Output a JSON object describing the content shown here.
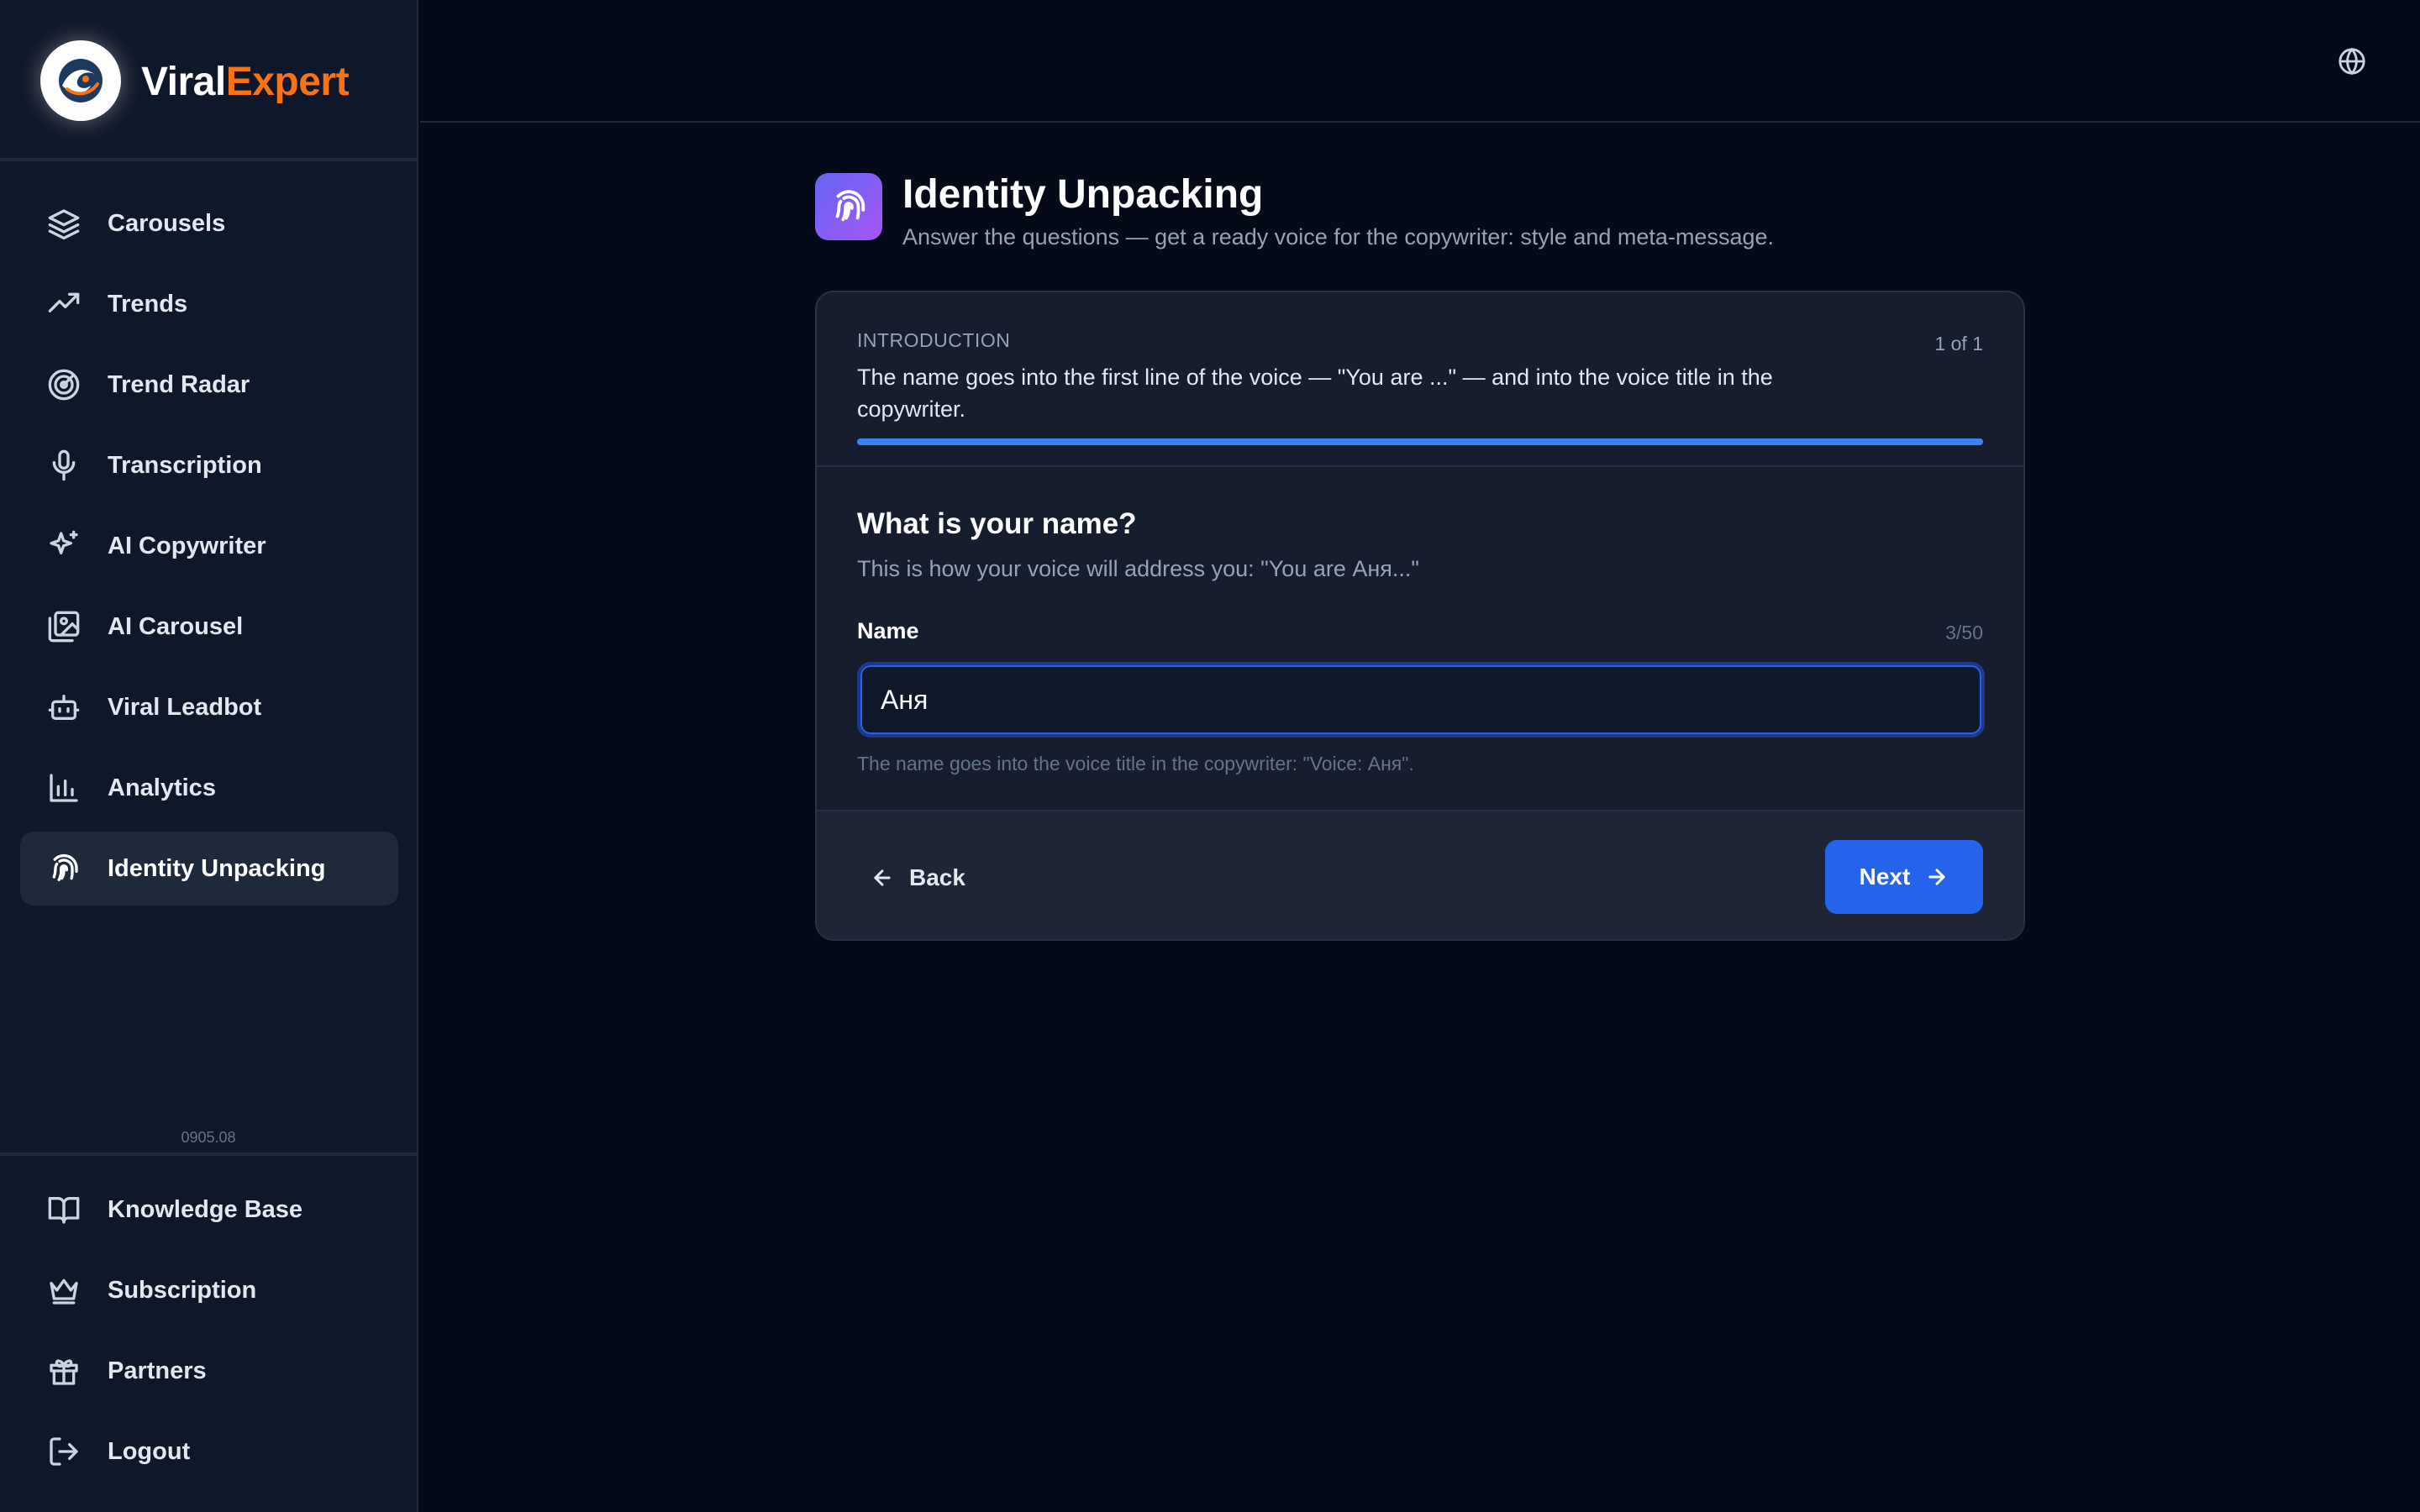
{
  "brand": {
    "name_part1": "Viral",
    "name_part2": "Expert",
    "accent_color": "#f97316"
  },
  "sidebar": {
    "items": [
      {
        "label": "Carousels",
        "icon": "layers-icon"
      },
      {
        "label": "Trends",
        "icon": "trending-up-icon"
      },
      {
        "label": "Trend Radar",
        "icon": "radar-icon"
      },
      {
        "label": "Transcription",
        "icon": "microphone-icon"
      },
      {
        "label": "AI Copywriter",
        "icon": "sparkles-icon"
      },
      {
        "label": "AI Carousel",
        "icon": "image-gallery-icon"
      },
      {
        "label": "Viral Leadbot",
        "icon": "bot-icon"
      },
      {
        "label": "Analytics",
        "icon": "bar-chart-icon"
      },
      {
        "label": "Identity Unpacking",
        "icon": "fingerprint-icon",
        "active": true
      }
    ],
    "version": "0905.08",
    "bottom_items": [
      {
        "label": "Knowledge Base",
        "icon": "book-open-icon"
      },
      {
        "label": "Subscription",
        "icon": "crown-icon"
      },
      {
        "label": "Partners",
        "icon": "gift-icon"
      },
      {
        "label": "Logout",
        "icon": "logout-icon"
      }
    ]
  },
  "header": {
    "language_icon": "globe-icon"
  },
  "page": {
    "title": "Identity Unpacking",
    "subtitle": "Answer the questions — get a ready voice for the copywriter: style and meta-message.",
    "icon": "fingerprint-icon",
    "icon_gradient": [
      "#6366f1",
      "#a855f7"
    ]
  },
  "step": {
    "section": "INTRODUCTION",
    "counter": "1 of 1",
    "description": "The name goes into the first line of the voice — \"You are ...\" — and into the voice title in the copywriter.",
    "progress": 1.0
  },
  "question": {
    "title": "What is your name?",
    "subtitle": "This is how your voice will address you: \"You are Аня...\"",
    "field_label": "Name",
    "char_count": "3/50",
    "value": "Аня",
    "hint": "The name goes into the voice title in the copywriter: \"Voice: Аня\"."
  },
  "actions": {
    "back": "Back",
    "next": "Next",
    "primary_color": "#2563eb"
  }
}
